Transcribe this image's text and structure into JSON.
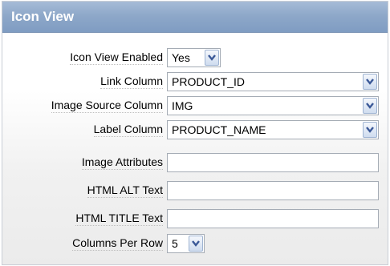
{
  "panel": {
    "title": "Icon View"
  },
  "fields": {
    "icon_view_enabled": {
      "label": "Icon View Enabled",
      "value": "Yes"
    },
    "link_column": {
      "label": "Link Column",
      "value": "PRODUCT_ID"
    },
    "image_source_column": {
      "label": "Image Source Column",
      "value": "IMG"
    },
    "label_column": {
      "label": "Label Column",
      "value": "PRODUCT_NAME"
    },
    "image_attributes": {
      "label": "Image Attributes",
      "value": ""
    },
    "html_alt_text": {
      "label": "HTML ALT Text",
      "value": ""
    },
    "html_title_text": {
      "label": "HTML TITLE Text",
      "value": ""
    },
    "columns_per_row": {
      "label": "Columns Per Row",
      "value": "5"
    }
  },
  "icons": {
    "dropdown": "chevron-down-icon"
  },
  "colors": {
    "header": "#8ea8c9",
    "header_text": "#ffffff",
    "field_border": "#a5acb5",
    "dropdown_arrow": "#3b5998"
  }
}
